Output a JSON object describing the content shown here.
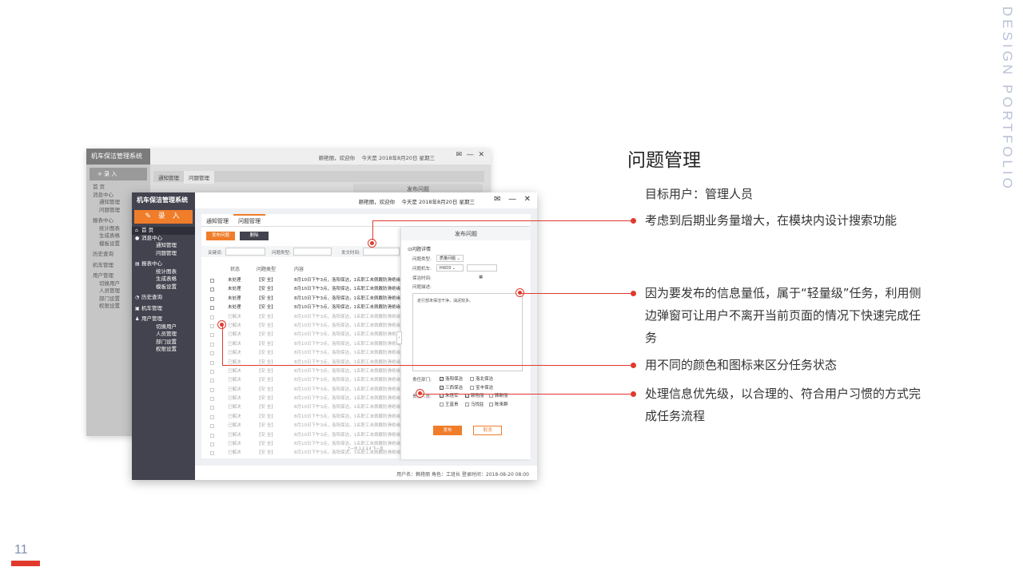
{
  "slide": {
    "vertical_label": "DESIGN PORTFOLIO",
    "page_number": "11",
    "title": "问题管理",
    "target_user": "目标用户：管理人员",
    "points": [
      "考虑到后期业务量增大，在模块内设计搜索功能",
      "因为要发布的信息量低，属于“轻量级”任务，利用侧边弹窗可让用户不离开当前页面的情况下快速完成任务",
      "用不同的颜色和图标来区分任务状态",
      "处理信息优先级，以合理的、符合用户习惯的方式完成任务流程"
    ],
    "accent_color": "#e03a2e"
  },
  "app": {
    "system_name": "机车保洁管理系统",
    "enter_label": "录 入",
    "back_enter_label": "+ 录 入",
    "greeting": "赖艳丽，欢迎你",
    "date": "今天是 2018年8月20日 星期三",
    "menu": [
      {
        "label": "首  页",
        "sub": []
      },
      {
        "label": "消息中心",
        "sub": [
          "通知管理",
          "问题管理"
        ]
      },
      {
        "label": "报表中心",
        "sub": [
          "统计图表",
          "生成表格",
          "模板设置"
        ]
      },
      {
        "label": "历史查询",
        "sub": []
      },
      {
        "label": "机车管理",
        "sub": []
      },
      {
        "label": "用户管理",
        "sub": [
          "切换用户",
          "人员管理",
          "部门设置",
          "权限设置"
        ]
      }
    ],
    "tabs": [
      "通知管理",
      "问题管理"
    ],
    "publish_button": "发布问题",
    "delete_button": "删除",
    "filters": {
      "keyword": "关键词:",
      "type": "问题类型:",
      "time": "发文时间:"
    },
    "columns": [
      "状态",
      "问题类型",
      "内容"
    ],
    "rows_pending": [
      {
        "status": "未处理",
        "type": "【安 全】",
        "content": "8月10日下午3点，洛阳保洁，1名职工未佩戴防滑绝缘"
      },
      {
        "status": "未处理",
        "type": "【安 全】",
        "content": "8月10日下午3点，洛阳保洁，1名职工未佩戴防滑绝缘"
      },
      {
        "status": "未处理",
        "type": "【安 全】",
        "content": "8月10日下午3点，洛阳保洁，1名职工未佩戴防滑绝缘"
      },
      {
        "status": "未处理",
        "type": "【安 全】",
        "content": "8月10日下午3点，洛阳保洁，1名职工未佩戴防滑绝缘"
      }
    ],
    "rows_done_status": "已解决",
    "rows_done_type": "【安 全】",
    "rows_done_content": "8月10日下午3点，洛阳保洁，1名职工未佩戴防滑绝缘",
    "pager": "上一页  1 2 3 4  下一页",
    "drawer": {
      "title": "发布问题",
      "section": "⊙问题详情",
      "type_label": "问题类型:",
      "type_value": "质量问题",
      "train_label": "问题机车:",
      "train_value": "HXD3",
      "time_label": "保洁时间:",
      "desc_label": "问题描述:",
      "desc_value": "走行部未保洁干净，油泥较多。",
      "dept_label": "责任部门:",
      "depts": [
        "洛阳保洁",
        "洛北保洁",
        "三西保洁",
        "宝丰保洁"
      ],
      "people_label": "责任人员:",
      "people": [
        "朱连军",
        "赖艳丽",
        "韩新丽",
        "王富贵",
        "马找驻",
        "陈来群"
      ],
      "publish": "发布",
      "cancel": "取消"
    },
    "footer": "用户名：赖艳丽    角色：工班长    登录时间：2018-08-20  08:00",
    "back_panel_header": "发布问题"
  }
}
